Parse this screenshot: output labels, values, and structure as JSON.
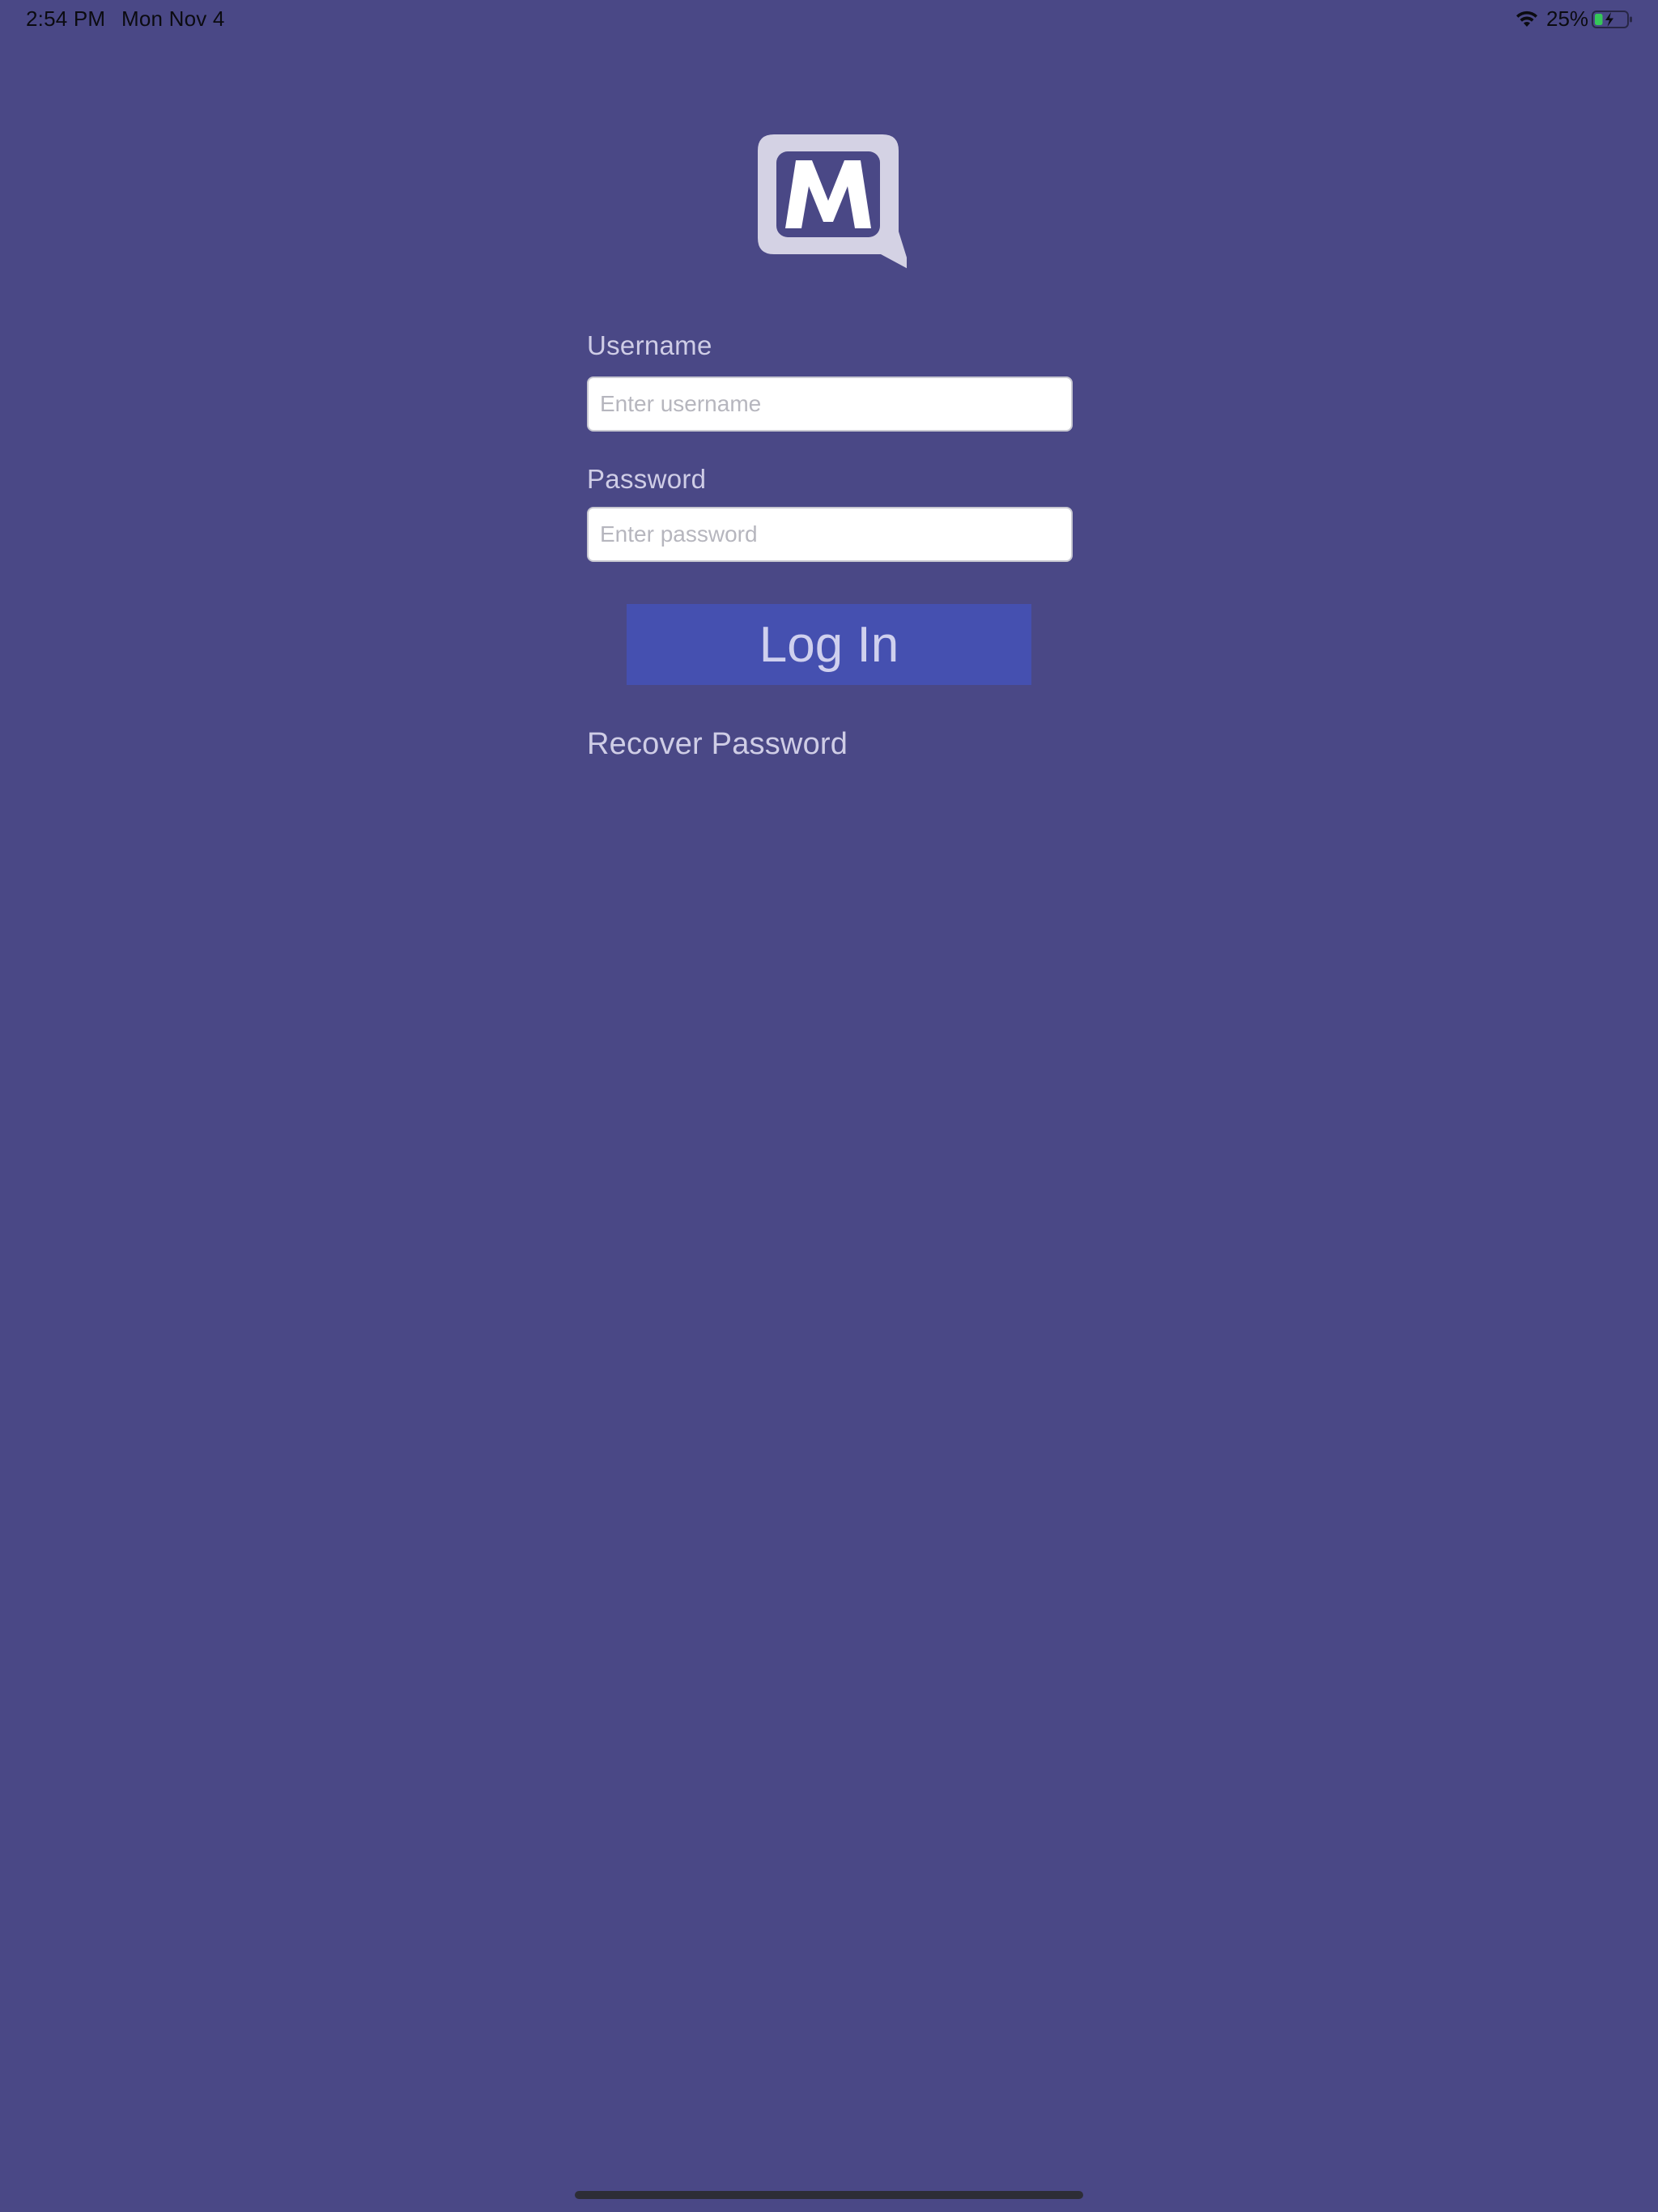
{
  "status_bar": {
    "time": "2:54 PM",
    "date": "Mon Nov 4",
    "battery_percent": "25%",
    "battery_level": 0.25,
    "icons": [
      "wifi-icon",
      "battery-charging-icon"
    ]
  },
  "logo": {
    "letter": "M",
    "icon": "chat-bubble-logo-icon"
  },
  "form": {
    "username_label": "Username",
    "username_value": "",
    "username_placeholder": "Enter username",
    "password_label": "Password",
    "password_value": "",
    "password_placeholder": "Enter password",
    "login_label": "Log In",
    "recover_label": "Recover Password"
  },
  "colors": {
    "background": "#4a4886",
    "button": "#4550b0",
    "text_light": "#cfcde6"
  }
}
